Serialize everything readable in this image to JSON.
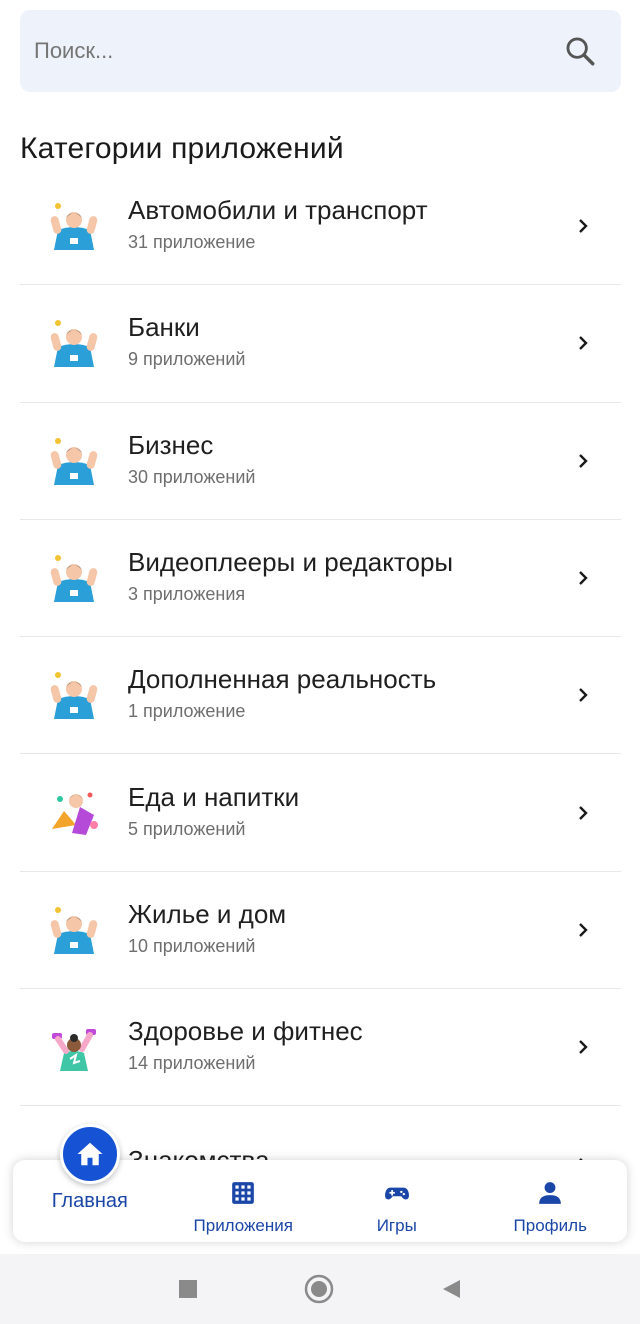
{
  "search": {
    "placeholder": "Поиск..."
  },
  "section_title": "Категории приложений",
  "categories": [
    {
      "title": "Автомобили и транспорт",
      "count": "31 приложение",
      "icon": "person-cheer-icon"
    },
    {
      "title": "Банки",
      "count": "9 приложений",
      "icon": "person-cheer-icon"
    },
    {
      "title": "Бизнес",
      "count": "30 приложений",
      "icon": "person-cheer-icon"
    },
    {
      "title": "Видеоплееры и редакторы",
      "count": "3 приложения",
      "icon": "person-cheer-icon"
    },
    {
      "title": "Дополненная реальность",
      "count": "1 приложение",
      "icon": "person-cheer-icon"
    },
    {
      "title": "Еда и напитки",
      "count": "5 приложений",
      "icon": "food-person-icon"
    },
    {
      "title": "Жилье и дом",
      "count": "10 приложений",
      "icon": "person-cheer-icon"
    },
    {
      "title": "Здоровье и фитнес",
      "count": "14 приложений",
      "icon": "fitness-person-icon"
    },
    {
      "title": "Знакомства",
      "count": "",
      "icon": "person-cheer-icon"
    }
  ],
  "nav": {
    "home": "Главная",
    "apps": "Приложения",
    "games": "Игры",
    "profile": "Профиль"
  },
  "colors": {
    "accent": "#1552d4",
    "nav_text": "#1a46a8",
    "search_bg": "#eef2fb"
  }
}
